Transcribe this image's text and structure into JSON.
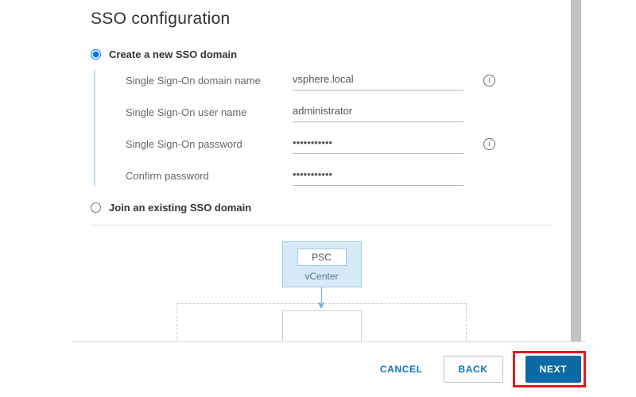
{
  "page": {
    "title": "SSO configuration"
  },
  "options": {
    "create": {
      "label": "Create a new SSO domain",
      "checked": true,
      "fields": {
        "domain_label": "Single Sign-On domain name",
        "domain_value": "vsphere.local",
        "user_label": "Single Sign-On user name",
        "user_value": "administrator",
        "password_label": "Single Sign-On password",
        "password_value": "•••••••••••",
        "confirm_label": "Confirm password",
        "confirm_value": "•••••••••••"
      }
    },
    "join": {
      "label": "Join an existing SSO domain",
      "checked": false
    }
  },
  "diagram": {
    "psc_label": "PSC",
    "vcenter_label": "vCenter"
  },
  "buttons": {
    "cancel": "CANCEL",
    "back": "BACK",
    "next": "NEXT"
  },
  "info_glyph": "i"
}
